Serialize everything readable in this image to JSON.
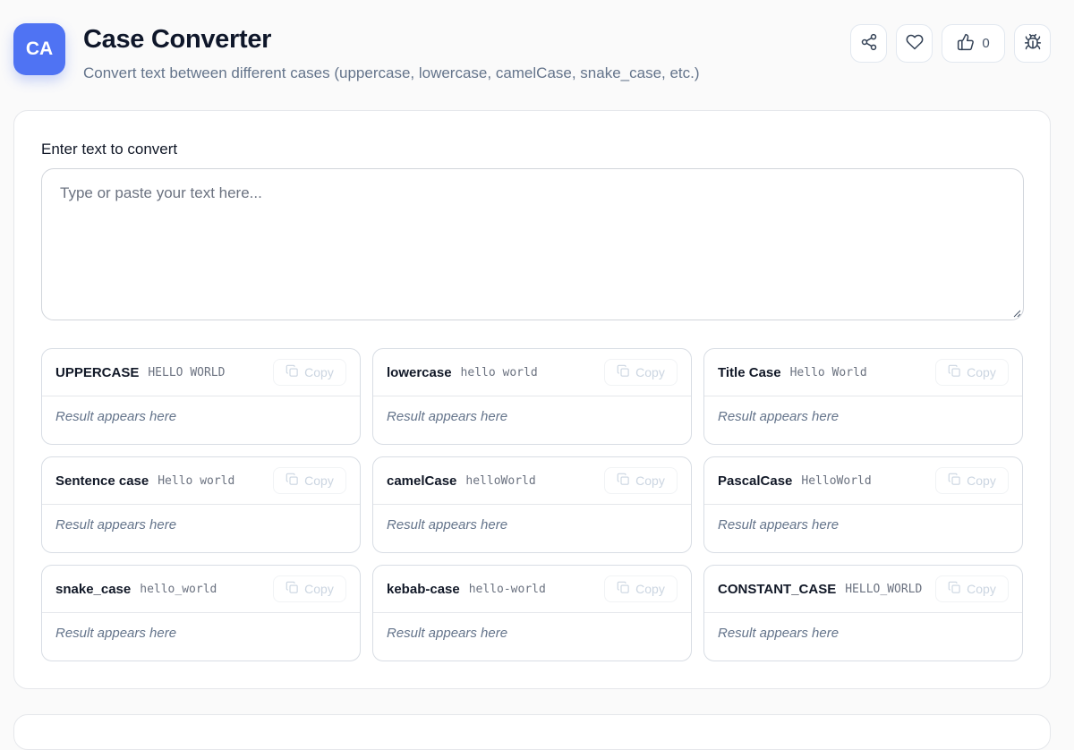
{
  "header": {
    "icon_text": "CA",
    "title": "Case Converter",
    "subtitle": "Convert text between different cases (uppercase, lowercase, camelCase, snake_case, etc.)",
    "like_count": "0",
    "actions": [
      "share-icon",
      "heart-icon",
      "thumbs-up-icon",
      "bug-icon"
    ]
  },
  "input": {
    "label": "Enter text to convert",
    "placeholder": "Type or paste your text here...",
    "value": ""
  },
  "copy_label": "Copy",
  "results": [
    {
      "name": "UPPERCASE",
      "sample": "HELLO WORLD",
      "result": "Result appears here"
    },
    {
      "name": "lowercase",
      "sample": "hello world",
      "result": "Result appears here"
    },
    {
      "name": "Title Case",
      "sample": "Hello World",
      "result": "Result appears here"
    },
    {
      "name": "Sentence case",
      "sample": "Hello world",
      "result": "Result appears here"
    },
    {
      "name": "camelCase",
      "sample": "helloWorld",
      "result": "Result appears here"
    },
    {
      "name": "PascalCase",
      "sample": "HelloWorld",
      "result": "Result appears here"
    },
    {
      "name": "snake_case",
      "sample": "hello_world",
      "result": "Result appears here"
    },
    {
      "name": "kebab-case",
      "sample": "hello-world",
      "result": "Result appears here"
    },
    {
      "name": "CONSTANT_CASE",
      "sample": "HELLO_WORLD",
      "result": "Result appears here"
    }
  ]
}
